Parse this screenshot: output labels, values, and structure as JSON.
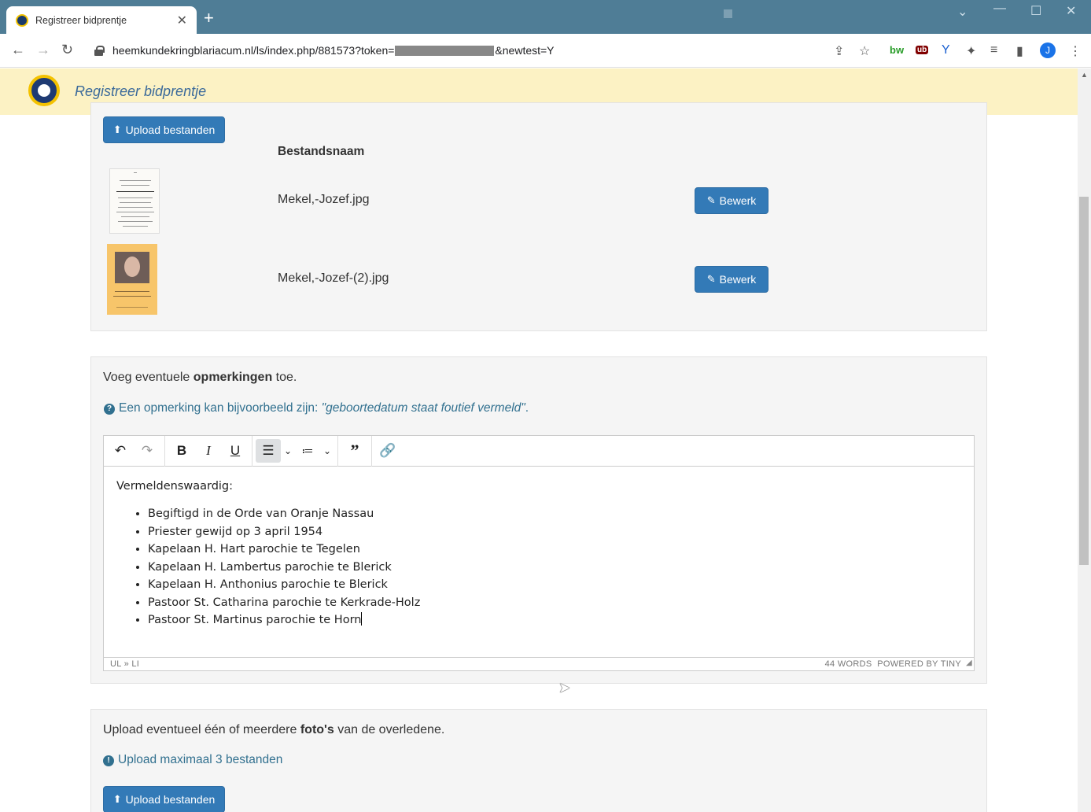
{
  "browser": {
    "tab_title": "Registreer bidprentje",
    "url_prefix": "heemkundekringblariacum.nl/ls/index.php/881573?token=",
    "url_suffix": "&newtest=Y",
    "profile_initial": "J",
    "ext_bw": "bw",
    "ext_ub": "ub"
  },
  "app": {
    "title": "Registreer bidprentje"
  },
  "files_section": {
    "upload_label": "Upload bestanden",
    "column_header": "Bestandsnaam",
    "files": [
      {
        "name": "Mekel,-Jozef.jpg",
        "edit_label": "Bewerk"
      },
      {
        "name": "Mekel,-Jozef-(2).jpg",
        "edit_label": "Bewerk"
      }
    ]
  },
  "remarks_section": {
    "intro_pre": "Voeg eventuele ",
    "intro_bold": "opmerkingen",
    "intro_post": " toe.",
    "hint_pre": "Een opmerking kan bijvoorbeeld zijn: ",
    "hint_em": "\"geboortedatum staat foutief vermeld\"",
    "hint_post": ".",
    "editor": {
      "heading": "Vermeldenswaardig:",
      "items": [
        "Begiftigd in de Orde van Oranje Nassau",
        "Priester gewijd op 3 april 1954",
        "Kapelaan H. Hart parochie te Tegelen",
        "Kapelaan H. Lambertus parochie te Blerick",
        "Kapelaan H. Anthonius parochie te Blerick",
        "Pastoor St. Catharina parochie te Kerkrade-Holz",
        "Pastoor St. Martinus parochie te Horn"
      ],
      "path": "UL » LI",
      "word_count": "44 WORDS",
      "powered_by": "POWERED BY TINY"
    }
  },
  "photos_section": {
    "intro_pre": "Upload eventueel één of meerdere ",
    "intro_bold": "foto's",
    "intro_post": " van de overledene.",
    "limit_note": "Upload maximaal 3 bestanden",
    "upload_label": "Upload bestanden"
  },
  "colors": {
    "primary": "#337ab7",
    "header_bg": "#fcf2c4",
    "tab_bar": "#4f7d96",
    "info_text": "#31708f"
  }
}
